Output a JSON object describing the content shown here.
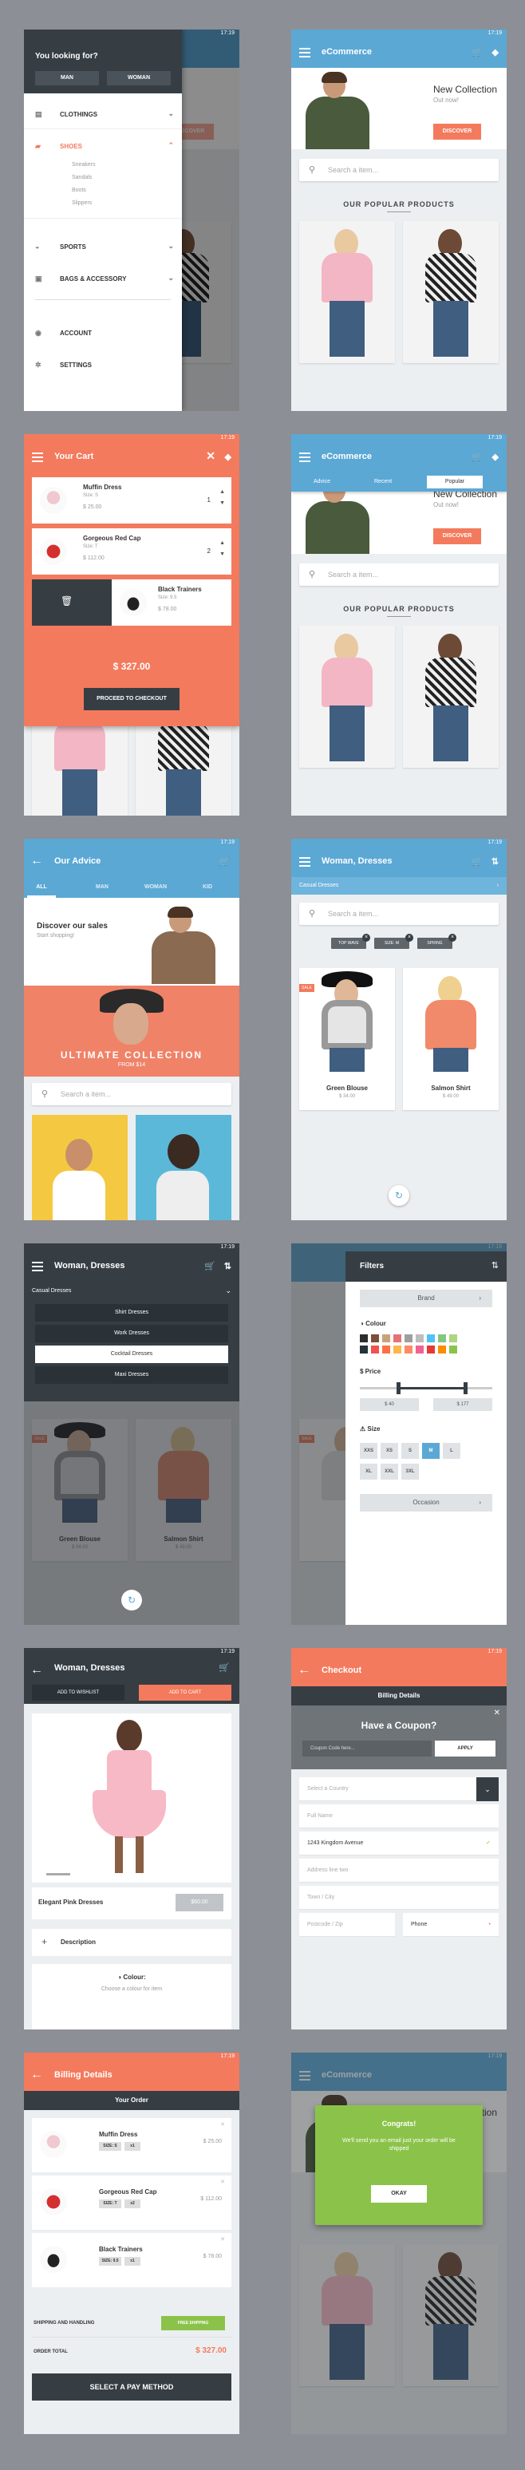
{
  "status_time": "17:19",
  "colors": {
    "blue": "#5ba8d5",
    "dark": "#363e44",
    "orange": "#f47a5d",
    "green": "#8bc34a"
  },
  "icons": [
    "menu-icon",
    "cart-icon",
    "tag-icon",
    "back-icon",
    "filter-icon",
    "search-icon",
    "close-icon",
    "trash-icon",
    "tune-icon"
  ],
  "menu": {
    "heading": "You looking for?",
    "man": "MAN",
    "woman": "WOMAN",
    "items": [
      "CLOTHINGS",
      "SHOES",
      "SPORTS",
      "BAGS & ACCESSORY",
      "ACCOUNT",
      "SETTINGS"
    ],
    "shoes_sub": [
      "Sneakers",
      "Sandals",
      "Boots",
      "Slippers"
    ]
  },
  "home": {
    "title": "eCommerce",
    "banner_title": "New Collection",
    "banner_sub": "Out now!",
    "discover": "DISCOVER",
    "search": "Search a item...",
    "popular": "OUR POPULAR PRODUCTS"
  },
  "cart": {
    "title": "Your Cart",
    "items": [
      {
        "name": "Muffin Dress",
        "size": "Size: S",
        "price": "$ 25.00",
        "qty": "1"
      },
      {
        "name": "Gorgeous Red Cap",
        "size": "Size: T",
        "price": "$ 112.00",
        "qty": "2"
      },
      {
        "name": "Black Trainers",
        "size": "Size: 9.5",
        "price": "$ 78.00"
      }
    ],
    "total": "$ 327.00",
    "checkout": "PROCEED TO CHECKOUT"
  },
  "home_tabs": {
    "tabs": [
      "Advice",
      "Recent",
      "Popular"
    ]
  },
  "advice": {
    "title": "Our Advice",
    "tabs": [
      "ALL",
      "MAN",
      "WOMAN",
      "KID"
    ],
    "discover_title": "Discover our sales",
    "discover_sub": "Start shopping!",
    "ultimate": "ULTIMATE COLLECTION",
    "from": "FROM $14",
    "search": "Search a item..."
  },
  "listing": {
    "title": "Woman,  Dresses",
    "category": "Casual Dresses",
    "search": "Search a item...",
    "chips": [
      "TOP WAVE",
      "SIZE: M",
      "SPRING"
    ],
    "sale": "SALE",
    "products": [
      {
        "name": "Green Blouse",
        "price": "$ 34.00"
      },
      {
        "name": "Salmon Shirt",
        "price": "$ 49.00"
      }
    ]
  },
  "categories": {
    "title": "Woman,  Dresses",
    "current": "Casual Dresses",
    "items": [
      "Shirt Dresses",
      "Work Dresses",
      "Cocktail Dresses",
      "Maxi Dresses"
    ]
  },
  "filters": {
    "title": "Filters",
    "brand": "Brand",
    "colour": "Colour",
    "price": "Price",
    "price_min": "$ 40",
    "price_max": "$ 177",
    "size": "Size",
    "sizes": [
      "XXS",
      "XS",
      "S",
      "M",
      "L",
      "XL",
      "XXL",
      "3XL"
    ],
    "occasion": "Occasion",
    "swatches": [
      "#2d2d2d",
      "#7b4f3a",
      "#c9a27c",
      "#e57373",
      "#9e9e9e",
      "#bdbdbd",
      "#4fc3f7",
      "#81c784",
      "#aed581",
      "#263238",
      "#ef5350",
      "#ff7043",
      "#ffb74d",
      "#ff8a65",
      "#f06292",
      "#e53935",
      "#fb8c00",
      "#8bc34a"
    ]
  },
  "product": {
    "title": "Woman, Dresses",
    "wishlist": "ADD TO WISHLIST",
    "add_cart": "ADD TO CART",
    "name": "Elegant Pink Dresses",
    "price": "$60.00",
    "description": "Description",
    "colour": "Colour:",
    "choose": "Choose a colour for item"
  },
  "checkout": {
    "title": "Checkout",
    "billing": "Billing Details",
    "coupon_title": "Have a Coupon?",
    "coupon_ph": "Coupon Code here...",
    "apply": "APPLY",
    "fields": [
      "Select a Country",
      "Full Name",
      "1243 Kingdom Avenue",
      "Address line two",
      "Town / City"
    ],
    "postcode": "Postcode / Zip",
    "phone": "Phone"
  },
  "order": {
    "title": "Billing Details",
    "header": "Your Order",
    "items": [
      {
        "name": "Muffin Dress",
        "size": "SIZE: S",
        "qty": "x1",
        "price": "$ 25.00"
      },
      {
        "name": "Gorgeous Red Cap",
        "size": "SIZE: T",
        "qty": "x2",
        "price": "$ 112.00"
      },
      {
        "name": "Black Trainers",
        "size": "SIZE: 9.5",
        "qty": "x1",
        "price": "$ 78.00"
      }
    ],
    "shipping": "SHIPPING AND HANDLING",
    "free": "FREE SHIPPING",
    "order_total": "ORDER TOTAL",
    "total": "$ 327.00",
    "pay": "SELECT A PAY METHOD"
  },
  "congrats": {
    "title": "Congrats!",
    "msg": "We'll send you an email just your order will be shipped",
    "ok": "OKAY",
    "app": "eCommerce"
  }
}
